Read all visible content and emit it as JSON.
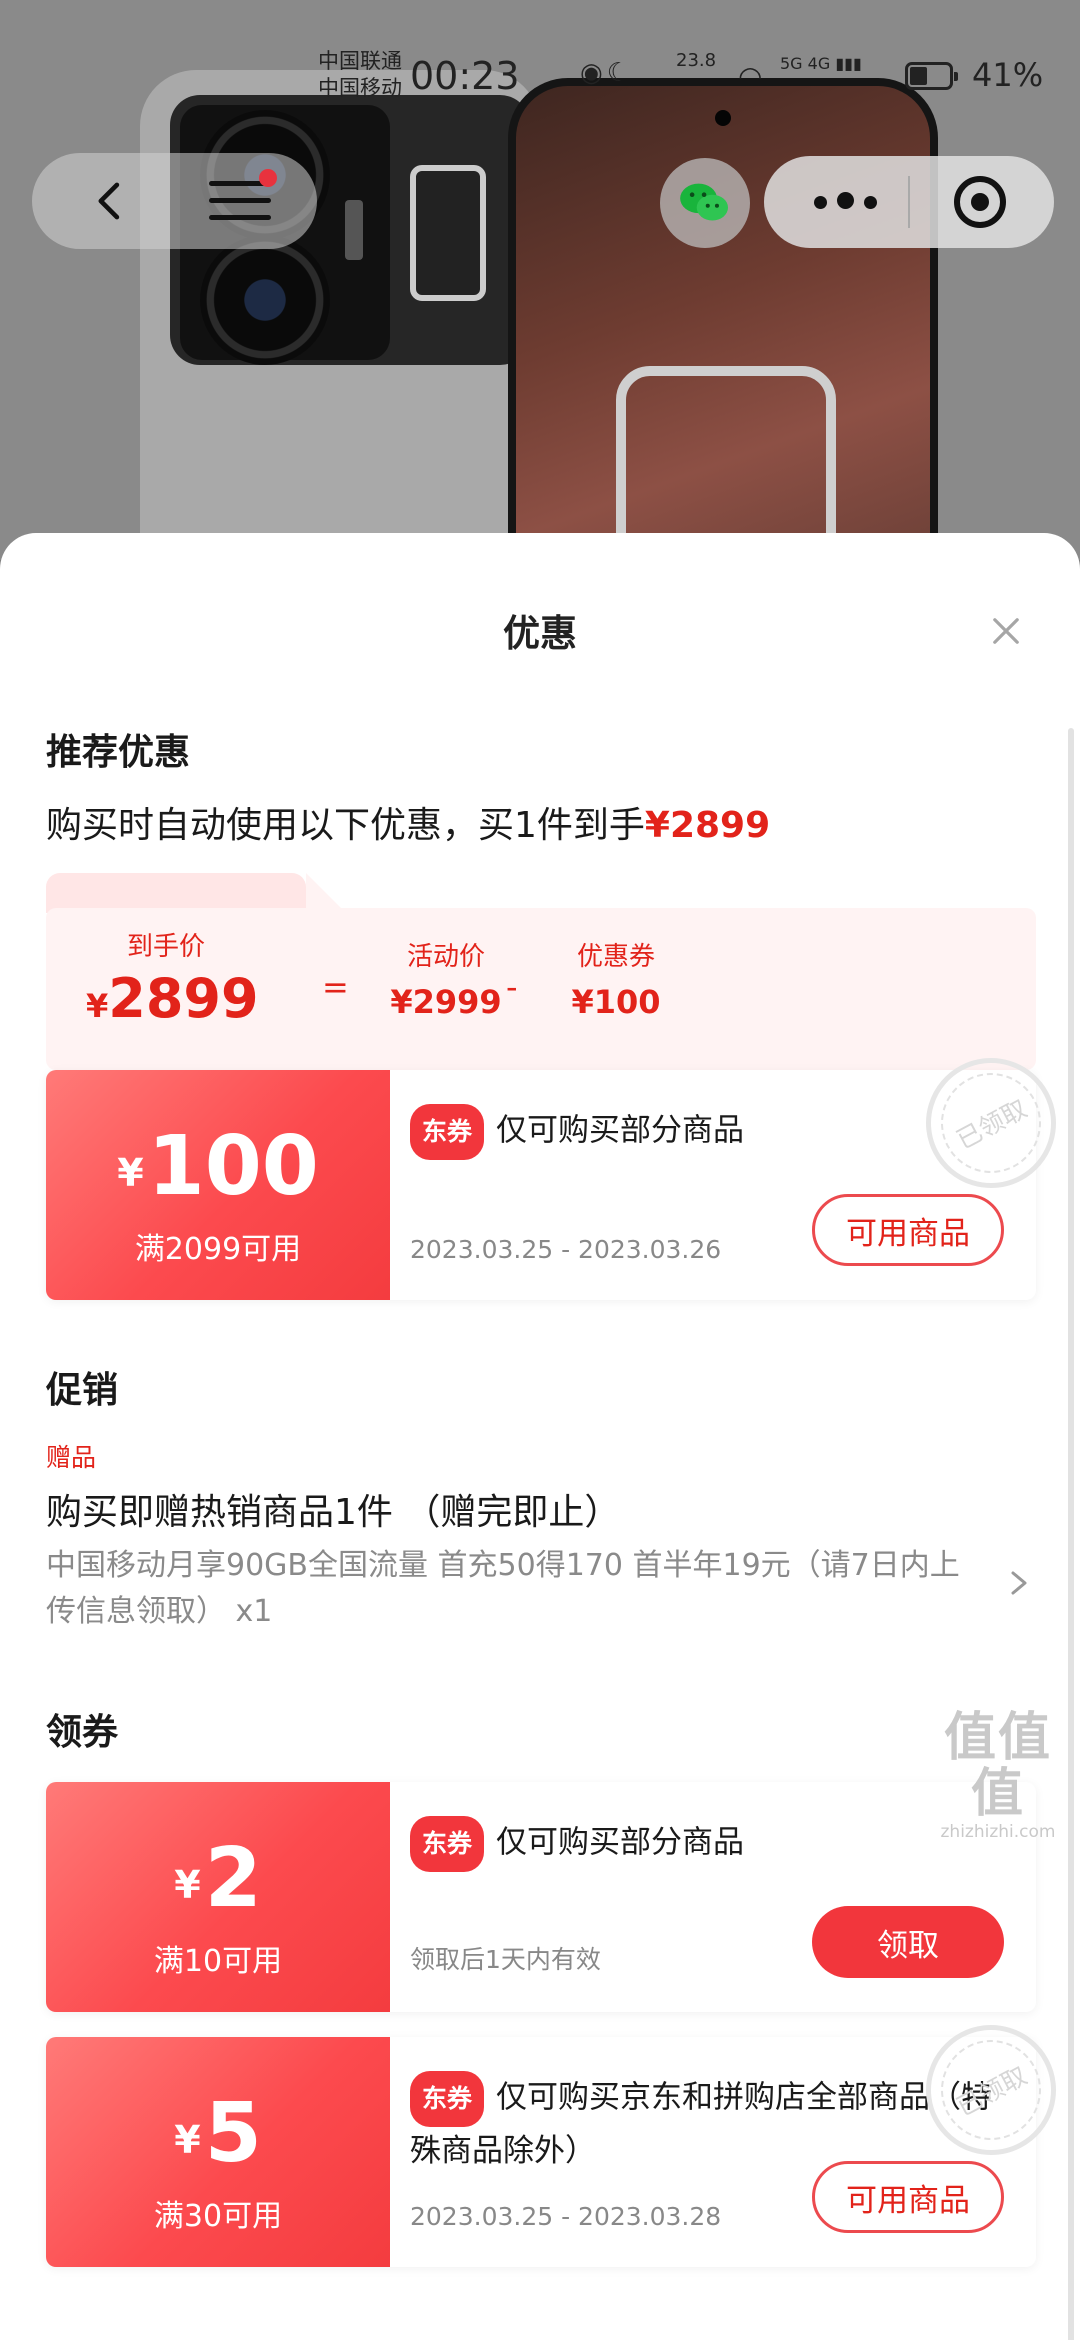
{
  "status_bar": {
    "carrier_1": "中国联通",
    "carrier_2": "中国移动",
    "time": "00:23",
    "net_speed": "23.8",
    "signal_text": "5G 4G",
    "battery": "41%"
  },
  "nav": {
    "back_icon": "chevron-left-icon",
    "menu_icon": "menu-icon",
    "share_icon": "wechat-icon",
    "more_icon": "more-dots-icon",
    "close_icon": "target-icon"
  },
  "sheet": {
    "title": "优惠",
    "close_icon": "close-icon"
  },
  "recommend": {
    "heading": "推荐优惠",
    "summary_prefix": "购买时自动使用以下优惠，买1件到手",
    "summary_price": "¥2899",
    "final_label": "到手价",
    "final_currency": "¥",
    "final_value": "2899",
    "equals": "=",
    "activity_label": "活动价",
    "activity_value": "¥2999",
    "minus": "-",
    "coupon_label": "优惠券",
    "coupon_value": "¥100"
  },
  "coupons_applied": [
    {
      "currency": "¥",
      "amount": "100",
      "condition": "满2099可用",
      "tag": "东券",
      "description": "仅可购买部分商品",
      "date": "2023.03.25 - 2023.03.26",
      "button": "可用商品",
      "stamp": "已领取"
    }
  ],
  "promotion": {
    "heading": "促销",
    "gift_tag": "赠品",
    "gift_title": "购买即赠热销商品1件 （赠完即止）",
    "gift_desc": "中国移动月享90GB全国流量 首充50得170 首半年19元（请7日内上传信息领取） x1"
  },
  "claim": {
    "heading": "领券",
    "coupons": [
      {
        "currency": "¥",
        "amount": "2",
        "condition": "满10可用",
        "tag": "东券",
        "description": "仅可购买部分商品",
        "date": "领取后1天内有效",
        "button": "领取"
      },
      {
        "currency": "¥",
        "amount": "5",
        "condition": "满30可用",
        "tag": "东券",
        "description": "仅可购买京东和拼购店全部商品（特殊商品除外）",
        "date": "2023.03.25 - 2023.03.28",
        "button": "可用商品",
        "stamp": "已领取"
      }
    ]
  },
  "watermark": {
    "logo": "值值值",
    "url": "zhizhizhi.com"
  },
  "colors": {
    "accent": "#e2231a",
    "coupon_gradient_start": "#ff7a78",
    "coupon_gradient_end": "#f43c3f",
    "price_box_bg": "#fff3f3"
  }
}
